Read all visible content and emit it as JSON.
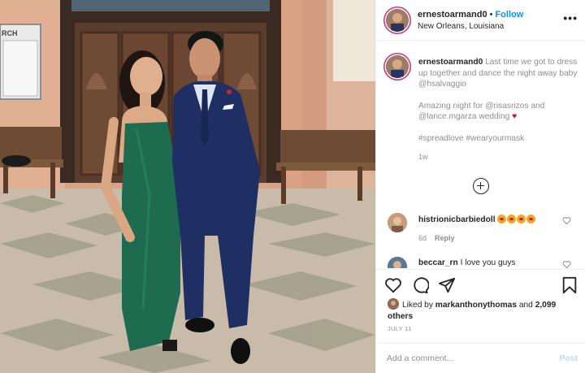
{
  "post": {
    "photo": {
      "sign_text": "RCH"
    },
    "header": {
      "username": "ernestoarmand0",
      "separator": "•",
      "follow_label": "Follow",
      "location": "New Orleans, Louisiana",
      "more_icon": "more-horizontal-icon",
      "more_label": "•••"
    },
    "caption": {
      "username": "ernestoarmand0",
      "line1": "Last time we got to dress up together and dance the night away baby",
      "mention1": "@hsalvaggio",
      "line2_prefix": "Amazing night for",
      "mention2": "@risasrizos",
      "and_word": "and",
      "mention3": "@lance.mgarza",
      "line2_suffix": "wedding",
      "heart_emoji": "♥",
      "hashtag1": "#spreadlove",
      "hashtag2": "#wearyourmask",
      "time": "1w"
    },
    "load_more_icon": "plus-circle-icon",
    "comments": [
      {
        "username": "histrionicbarbiedoll",
        "text": "",
        "emoji_count": 4,
        "age": "6d",
        "reply_label": "Reply",
        "like_icon": "heart-outline-icon"
      },
      {
        "username": "beccar_rn",
        "text": "I love you guys",
        "age": "",
        "reply_label": "",
        "like_icon": "heart-outline-icon"
      }
    ],
    "actions": {
      "like_icon": "heart-outline-icon",
      "comment_icon": "comment-icon",
      "share_icon": "paper-plane-icon",
      "save_icon": "bookmark-icon"
    },
    "likes": {
      "prefix": "Liked by",
      "user": "markanthonythomas",
      "and_word": "and",
      "others": "2,099 others"
    },
    "date": "JULY 11",
    "add_comment": {
      "placeholder": "Add a comment...",
      "post_label": "Post"
    },
    "colors": {
      "accent": "#0095f6",
      "hashtag": "#00376b",
      "muted": "#8e8e8e",
      "post_disabled": "#b2dffc",
      "dress": "#1e6b50",
      "suit": "#1f2f63"
    }
  }
}
